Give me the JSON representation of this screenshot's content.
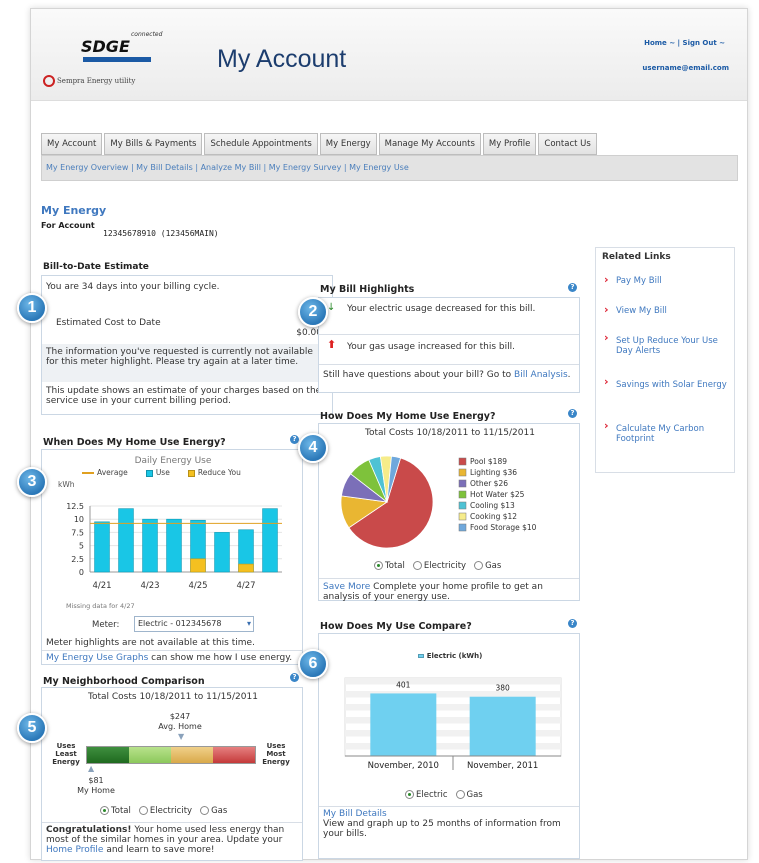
{
  "header": {
    "logo_text": "SDGE",
    "logo_connected": "connected",
    "logo_sempra": "Sempra Energy utility",
    "title": "My Account",
    "links": "Home ~ | Sign Out ~",
    "user": "username@email.com"
  },
  "tabs": [
    "My Account",
    "My Bills & Payments",
    "Schedule Appointments",
    "My Energy",
    "Manage My Accounts",
    "My Profile",
    "Contact Us"
  ],
  "subnav": "My Energy Overview |  My Bill Details |  Analyze My Bill |  My Energy Survey |  My Energy Use",
  "page": {
    "section_title": "My Energy",
    "account_label": "For Account",
    "account_value": "12345678910  (123456MAIN)"
  },
  "bill_estimate": {
    "title": "Bill-to-Date Estimate",
    "days": "You are 34 days into your billing cycle.",
    "cost_label": "Estimated Cost to Date",
    "cost_value": "$0.00",
    "note": "The information you've requested is currently not available for this meter highlight. Please try again at a later time.",
    "desc": "This update shows an estimate of your charges based on the service use in your current billing period."
  },
  "badges": [
    "1",
    "2",
    "3",
    "4",
    "5",
    "6"
  ],
  "highlights": {
    "title": "My Bill Highlights",
    "item1": "Your electric usage decreased for this bill.",
    "item2": "Your gas usage increased for this bill.",
    "question": "Still have questions about your bill? Go to",
    "link": "Bill Analysis",
    "period": "."
  },
  "usage": {
    "title": "When Does My Home Use Energy?",
    "chart_title": "Daily Energy Use",
    "legend": [
      "Average",
      "Use",
      "Reduce You"
    ],
    "unit": "kWh",
    "missing": "Missing data for  4/27",
    "meter_label": "Meter:",
    "meter_value": "Electric - 012345678",
    "not_available": "Meter highlights are not available at this time.",
    "link": "My Energy Use Graphs",
    "link_rest": "can show me how I use energy."
  },
  "home_use": {
    "title": "How Does My Home Use Energy?",
    "subtitle": "Total Costs 10/18/2011 to 11/15/2011",
    "radios": [
      "Total",
      "Electricity",
      "Gas"
    ],
    "save_link": "Save More",
    "save_text": "Complete your home profile to get an analysis of your energy use."
  },
  "compare": {
    "title": "How Does My Use Compare?",
    "legend": "Electric (kWh)",
    "radios": [
      "Electric",
      "Gas"
    ],
    "link": "My Bill Details",
    "desc": "View and graph up to 25 months of information from your bills."
  },
  "neighborhood": {
    "title": "My Neighborhood Comparison",
    "subtitle": "Total Costs 10/18/2011 to 11/15/2011",
    "avg_value": "$247",
    "avg_label": "Avg. Home",
    "left_label": "Uses Least Energy",
    "right_label": "Uses Most Energy",
    "my_value": "$81",
    "my_label": "My Home",
    "radios": [
      "Total",
      "Electricity",
      "Gas"
    ],
    "congrats_bold": "Congratulations!",
    "congrats": "Your home used less energy than most of the similar homes in your area. Update your",
    "profile_link": "Home Profile",
    "congrats_end": "and learn to save more!"
  },
  "related": {
    "title": "Related Links",
    "items": [
      "Pay My Bill",
      "View My Bill",
      "Set Up Reduce Your Use Day Alerts",
      "Savings with Solar Energy",
      "Calculate My Carbon Footprint"
    ]
  },
  "chart_data": [
    {
      "type": "bar",
      "title": "Daily Energy Use",
      "ylabel": "kWh",
      "ylim": [
        0,
        12.5
      ],
      "yticks": [
        "12.5",
        "10",
        "7.5",
        "5",
        "2.5",
        "0"
      ],
      "xtick_labels": [
        "4/21",
        "4/23",
        "4/25",
        "4/27"
      ],
      "series": [
        {
          "name": "Use",
          "color": "#19c6e6",
          "values": [
            9.5,
            12,
            10,
            10,
            9.8,
            7.5,
            8,
            12
          ]
        },
        {
          "name": "Reduce You",
          "color": "#f4c020",
          "values": [
            0,
            0,
            0,
            0,
            2.5,
            0,
            1.5,
            0
          ]
        },
        {
          "name": "Average",
          "color": "#e0a020",
          "values": [
            9.2,
            9.2,
            9.2,
            9.2,
            9.2,
            9.2,
            9.2,
            9.2
          ]
        }
      ]
    },
    {
      "type": "pie",
      "title": "Total Costs 10/18/2011 to 11/15/2011",
      "slices": [
        {
          "label": "Pool $189",
          "value": 189,
          "color": "#c94a4a"
        },
        {
          "label": "Lighting $36",
          "value": 36,
          "color": "#e9b632"
        },
        {
          "label": "Other $26",
          "value": 26,
          "color": "#7b6fb8"
        },
        {
          "label": "Hot Water $25",
          "value": 25,
          "color": "#7ec23b"
        },
        {
          "label": "Cooling $13",
          "value": 13,
          "color": "#4ec2d4"
        },
        {
          "label": "Cooking $12",
          "value": 12,
          "color": "#f6ec8a"
        },
        {
          "label": "Food Storage $10",
          "value": 10,
          "color": "#6fa8dc"
        }
      ]
    },
    {
      "type": "bar",
      "title": "",
      "series": [
        {
          "name": "Electric (kWh)",
          "color": "#6fd0f0",
          "values": [
            401,
            380
          ]
        }
      ],
      "categories": [
        "November, 2010",
        "November, 2011"
      ],
      "ylim": [
        0,
        500
      ]
    }
  ]
}
